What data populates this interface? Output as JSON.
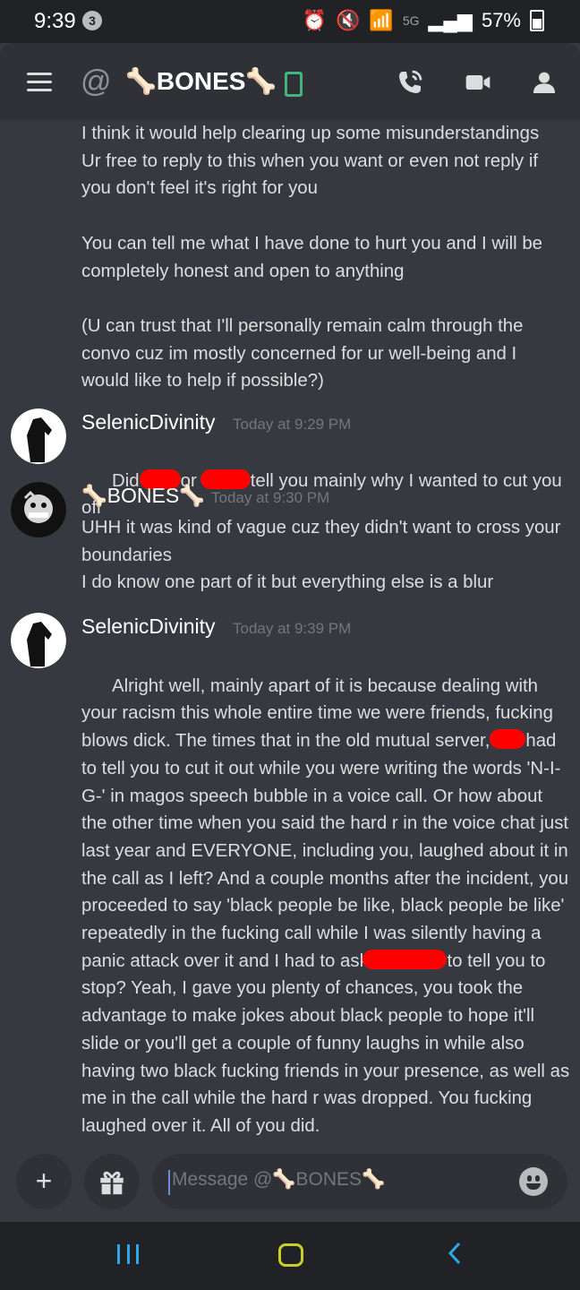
{
  "status_bar": {
    "time": "9:39",
    "notification_count": "3",
    "network": "5G",
    "battery": "57%"
  },
  "header": {
    "at_symbol": "@",
    "channel_name": "🦴BONES🦴"
  },
  "messages": {
    "continued": {
      "text": "I think it would help clearing up some misunderstandings\nUr free to reply to this when you want or even not reply if you don't feel it's right for you\n\nYou can tell me what I have done to hurt you and I will be completely honest and open to anything\n\n(U can trust that I'll personally remain calm through the convo cuz im mostly concerned for ur well-being and I would like to help if possible?)"
    },
    "m1": {
      "author": "SelenicDivinity",
      "timestamp": "Today at 9:29 PM",
      "part1": "Did",
      "part2": "or",
      "part3": "tell you mainly why I wanted to cut you off"
    },
    "m2": {
      "author": "🦴BONES🦴",
      "timestamp": "Today at 9:30 PM",
      "text": "UHH it was kind of vague cuz they didn't want to cross your boundaries\nI do know one part of it but everything else is a blur"
    },
    "m3": {
      "author": "SelenicDivinity",
      "timestamp": "Today at 9:39 PM",
      "part1": "Alright well, mainly apart of it is because dealing with your racism this whole entire time we were friends, fucking blows dick. The times that in the old mutual server,",
      "part2": "had to tell you to cut it out while you were writing the words 'N-I-G-' in magos speech bubble in a voice call. Or how about the other time when you said the hard r in the voice chat just last year and EVERYONE, including you, laughed about it in the call as I left? And a couple months after the incident, you proceeded to say 'black people be like, black people be like' repeatedly in the fucking call while I was silently having a panic attack over it and I had to ask",
      "part3": "to tell you to stop? Yeah, I gave you plenty of chances, you took the advantage to make jokes about black people to hope it'll slide or you'll get a couple of funny laughs in while also having two black fucking friends in your presence, as well as me in the call while the hard r was dropped. You fucking laughed over it. All of you did."
    }
  },
  "input": {
    "placeholder": "Message @🦴BONES🦴",
    "plus": "+"
  }
}
